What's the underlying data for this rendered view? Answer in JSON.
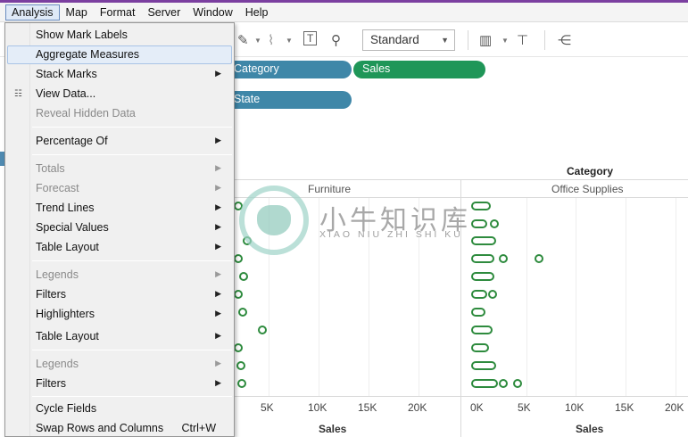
{
  "menubar": {
    "items": [
      "Analysis",
      "Map",
      "Format",
      "Server",
      "Window",
      "Help"
    ],
    "active": "Analysis"
  },
  "toolbar": {
    "mark_size_select": "Standard"
  },
  "shelves": {
    "columns_pills": [
      "Category",
      "Sales"
    ],
    "rows_pills": [
      "State"
    ]
  },
  "view": {
    "header_title": "Category",
    "panes": [
      "Furniture",
      "Office Supplies"
    ],
    "axis_title": "Sales",
    "furniture_ticks": [
      "5K",
      "10K",
      "15K",
      "20K"
    ],
    "office_ticks": [
      "0K",
      "5K",
      "10K",
      "15K",
      "20K"
    ]
  },
  "watermark": {
    "cn": "小牛知识库",
    "en": "XIAO NIU ZHI SHI KU"
  },
  "analysis_menu": {
    "show_mark_labels": "Show Mark Labels",
    "aggregate_measures": "Aggregate Measures",
    "stack_marks": "Stack Marks",
    "view_data": "View Data...",
    "reveal_hidden_data": "Reveal Hidden Data",
    "percentage_of": "Percentage Of",
    "totals": "Totals",
    "forecast": "Forecast",
    "trend_lines": "Trend Lines",
    "special_values": "Special Values",
    "table_layout": "Table Layout",
    "legends": "Legends",
    "filters": "Filters",
    "highlighters": "Highlighters",
    "table_layout_2": "Table Layout",
    "legends_2": "Legends",
    "filters_2": "Filters",
    "cycle_fields": "Cycle Fields",
    "swap_rows_columns": "Swap Rows and Columns",
    "swap_shortcut": "Ctrl+W"
  },
  "colors": {
    "pill_dimension": "#3f87a8",
    "pill_measure": "#1f9658",
    "mark": "#2e8b3e",
    "menu_hover": "#e4edf8"
  }
}
